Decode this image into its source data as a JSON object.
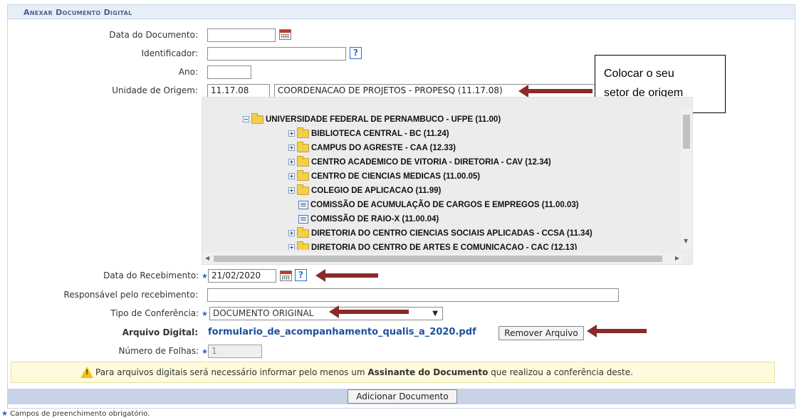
{
  "panel": {
    "title": "Anexar Documento Digital"
  },
  "fields": {
    "data_documento": {
      "label": "Data do Documento:",
      "value": ""
    },
    "identificador": {
      "label": "Identificador:",
      "value": ""
    },
    "ano": {
      "label": "Ano:",
      "value": ""
    },
    "unidade_origem": {
      "label": "Unidade de Origem:",
      "code": "11.17.08",
      "name": "COORDENACAO DE PROJETOS - PROPESQ (11.17.08)"
    },
    "data_recebimento": {
      "label": "Data do Recebimento:",
      "value": "21/02/2020"
    },
    "responsavel": {
      "label": "Responsável pelo recebimento:",
      "value": ""
    },
    "tipo_conferencia": {
      "label": "Tipo de Conferência:",
      "selected": "DOCUMENTO ORIGINAL"
    },
    "arquivo_digital": {
      "label": "Arquivo Digital:",
      "filename": "formulario_de_acompanhamento_qualis_a_2020.pdf",
      "remove_label": "Remover Arquivo"
    },
    "numero_folhas": {
      "label": "Número de Folhas:",
      "value": "1"
    }
  },
  "tree": {
    "root": "UNIVERSIDADE FEDERAL DE PERNAMBUCO - UFPE (11.00)",
    "items": [
      {
        "label": "BIBLIOTECA CENTRAL - BC (11.24)",
        "type": "folder"
      },
      {
        "label": "CAMPUS DO AGRESTE - CAA (12.33)",
        "type": "folder"
      },
      {
        "label": "CENTRO ACADEMICO DE VITORIA - DIRETORIA - CAV (12.34)",
        "type": "folder"
      },
      {
        "label": "CENTRO DE CIENCIAS MEDICAS (11.00.05)",
        "type": "folder"
      },
      {
        "label": "COLEGIO DE APLICACAO (11.99)",
        "type": "folder"
      },
      {
        "label": "COMISSÃO DE ACUMULAÇÃO DE CARGOS E EMPREGOS (11.00.03)",
        "type": "doc"
      },
      {
        "label": "COMISSÃO DE RAIO-X (11.00.04)",
        "type": "doc"
      },
      {
        "label": "DIRETORIA DO CENTRO CIENCIAS SOCIAIS APLICADAS - CCSA (11.34)",
        "type": "folder"
      },
      {
        "label": "DIRETORIA DO CENTRO DE ARTES E COMUNICACAO - CAC (12.13)",
        "type": "folder"
      }
    ]
  },
  "annotation": {
    "line1": "Colocar o seu",
    "line2": "setor de origem"
  },
  "notice": {
    "before": "Para arquivos digitais será necessário informar pelo menos um ",
    "bold": "Assinante do Documento",
    "after": " que realizou a conferência deste."
  },
  "actions": {
    "add_label": "Adicionar Documento"
  },
  "footer": {
    "required_note": "Campos de preenchimento obrigatório.",
    "required_mark": "★"
  },
  "icons": {
    "calendar": "calendar-icon",
    "help": "help-icon",
    "folder": "folder-icon",
    "document": "document-icon",
    "warning": "warning-icon"
  },
  "colors": {
    "accent": "#2b65c9",
    "arrow": "#8a2a2a",
    "header_bg": "#e8eef8"
  }
}
